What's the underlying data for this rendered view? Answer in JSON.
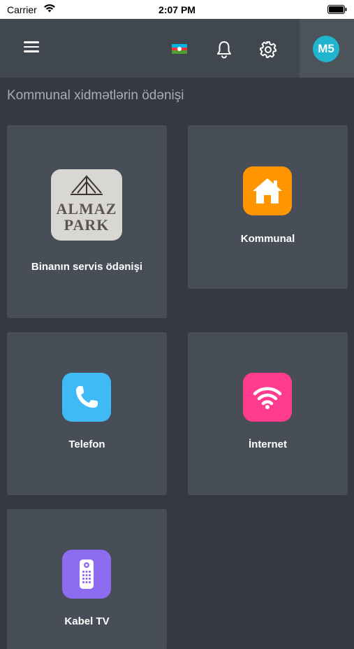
{
  "status_bar": {
    "carrier": "Carrier",
    "time": "2:07 PM"
  },
  "header": {
    "avatar_initials": "M5",
    "flag_colors": [
      "#00b5e2",
      "#ef3340",
      "#509e2f"
    ]
  },
  "page": {
    "title": "Kommunal xidmətlərin ödənişi"
  },
  "tiles": [
    {
      "label": "Binanın servis ödənişi",
      "logo_line1": "ALMAZ",
      "logo_line2": "PARK"
    },
    {
      "label": "Kommunal",
      "icon": "home-icon",
      "color": "#ff9500"
    },
    {
      "label": "Telefon",
      "icon": "phone-icon",
      "color": "#40b9f7"
    },
    {
      "label": "İnternet",
      "icon": "wifi-icon",
      "color": "#ff3b8d"
    },
    {
      "label": "Kabel TV",
      "icon": "remote-control-icon",
      "color": "#8e6cf0"
    }
  ]
}
